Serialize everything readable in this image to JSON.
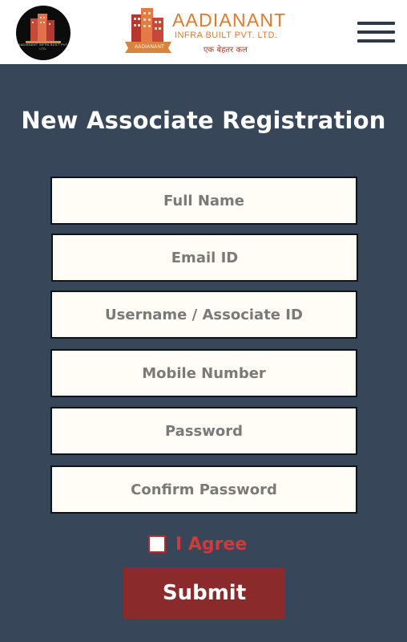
{
  "header": {
    "logo_small_text": "AADIANANT INFRA BUILT PVT. LTD.",
    "brand_name": "AADIANANT",
    "brand_subtitle": "INFRA BUILT PVT. LTD.",
    "brand_tagline": "एक बेहतर कल",
    "ribbon_label": "AADIANANT"
  },
  "page": {
    "title": "New Associate Registration"
  },
  "form": {
    "fields": [
      {
        "placeholder": "Full Name"
      },
      {
        "placeholder": "Email ID"
      },
      {
        "placeholder": "Username / Associate ID"
      },
      {
        "placeholder": "Mobile Number"
      },
      {
        "placeholder": "Password"
      },
      {
        "placeholder": "Confirm Password"
      }
    ],
    "agree_label": "I Agree",
    "agree_checked": false,
    "submit_label": "Submit"
  },
  "colors": {
    "background": "#374659",
    "accent": "#8a2a2a",
    "brand_orange": "#e07a2c",
    "agree_red": "#d13a36"
  },
  "icons": {
    "logo": "building-logo-icon",
    "menu": "hamburger-menu-icon"
  }
}
